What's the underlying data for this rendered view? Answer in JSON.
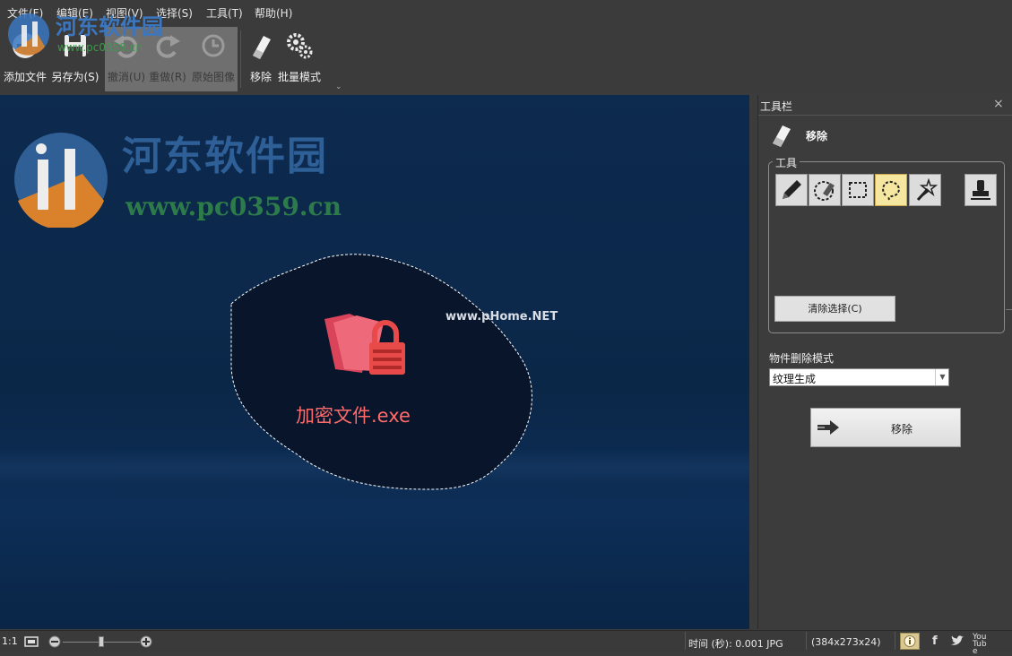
{
  "menu": [
    "文件(F)",
    "编辑(E)",
    "视图(V)",
    "选择(S)",
    "工具(T)",
    "帮助(H)"
  ],
  "ribbon": {
    "add_file": "添加文件",
    "save_as": "另存为(S)",
    "undo": "撤消(U)",
    "redo": "重做(R)",
    "original": "原始图像",
    "remove": "移除",
    "batch": "批量模式"
  },
  "overlay_watermark": {
    "title": "河东软件园",
    "url": "www.pc0359.cn"
  },
  "canvas": {
    "watermark_title": "河东软件园",
    "watermark_url": "www.pc0359.cn",
    "phome": "www.pHome.NET",
    "file_name": "加密文件.exe"
  },
  "panel": {
    "header": "工具栏",
    "close": "×",
    "tool_title": "移除",
    "tools_group": "工具",
    "tools": [
      "pencil-icon",
      "eraser-lasso-icon",
      "rect-select-icon",
      "lasso-icon",
      "magic-wand-icon",
      "stamp-icon"
    ],
    "active_tool": "lasso-icon",
    "clear_button": "清除选择(C)",
    "mode_label": "物件删除模式",
    "mode_value": "纹理生成",
    "remove_button": "移除"
  },
  "status": {
    "zoom_ratio": "1:1",
    "time": "时间 (秒): 0.001 JPG",
    "dims": "(384x273x24)",
    "social": [
      "info-icon",
      "facebook-icon",
      "twitter-icon",
      "youtube-icon"
    ],
    "facebook": "f",
    "youtube": "You Tube"
  },
  "colors": {
    "accent_active": "#f6e7a0",
    "canvas_bg": "#0b2748",
    "file_text": "#ff6a6a"
  }
}
